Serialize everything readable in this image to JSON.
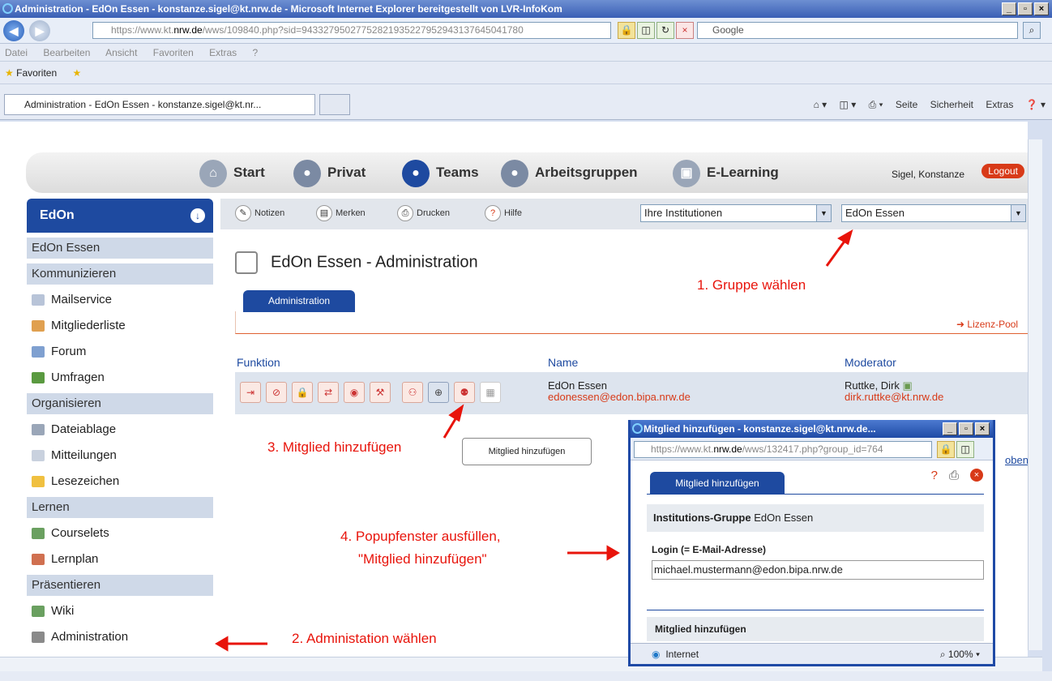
{
  "window": {
    "title": "Administration - EdOn Essen - konstanze.sigel@kt.nrw.de - Microsoft Internet Explorer bereitgestellt von LVR-InfoKom",
    "url_prefix": "https://www.kt.",
    "url_domain": "nrw.de",
    "url_rest": "/wws/109840.php?sid=94332795027752821935227952943137645041780",
    "search_placeholder": "Google",
    "menu": [
      "Datei",
      "Bearbeiten",
      "Ansicht",
      "Favoriten",
      "Extras",
      "?"
    ],
    "favorites": "Favoriten",
    "tab_title": "Administration - EdOn Essen - konstanze.sigel@kt.nr...",
    "cmd": [
      "Seite",
      "Sicherheit",
      "Extras"
    ]
  },
  "topnav": {
    "items": [
      "Start",
      "Privat",
      "Teams",
      "Arbeitsgruppen",
      "E-Learning"
    ],
    "user": "Sigel, Konstanze",
    "logout": "Logout"
  },
  "sidebar": {
    "header": "EdOn",
    "group": "EdOn Essen",
    "sections": [
      {
        "title": "Kommunizieren",
        "items": [
          "Mailservice",
          "Mitgliederliste",
          "Forum",
          "Umfragen"
        ]
      },
      {
        "title": "Organisieren",
        "items": [
          "Dateiablage",
          "Mitteilungen",
          "Lesezeichen"
        ]
      },
      {
        "title": "Lernen",
        "items": [
          "Courselets",
          "Lernplan"
        ]
      },
      {
        "title": "Präsentieren",
        "items": [
          "Wiki",
          "Administration"
        ]
      }
    ]
  },
  "toolbar": {
    "notizen": "Notizen",
    "merken": "Merken",
    "drucken": "Drucken",
    "hilfe": "Hilfe",
    "select1": "Ihre Institutionen",
    "select2": "EdOn Essen"
  },
  "main": {
    "title": "EdOn Essen - Administration",
    "tab": "Administration",
    "lizenz": "Lizenz-Pool",
    "col_funktion": "Funktion",
    "col_name": "Name",
    "col_moderator": "Moderator",
    "row_name": "EdOn Essen",
    "row_email": "edonessen@edon.bipa.nrw.de",
    "row_mod": "Ruttke, Dirk",
    "row_mod_email": "dirk.ruttke@kt.nrw.de",
    "tooltip": "Mitglied hinzufügen",
    "oben": "oben"
  },
  "annotations": {
    "a1": "1. Gruppe wählen",
    "a2": "2. Administation wählen",
    "a3": "3. Mitglied hinzufügen",
    "a4_line1": "4. Popupfenster ausfüllen,",
    "a4_line2": "\"Mitglied hinzufügen\""
  },
  "popup": {
    "title": "Mitglied hinzufügen - konstanze.sigel@kt.nrw.de...",
    "url_prefix": "https://www.kt.",
    "url_domain": "nrw.de",
    "url_rest": "/wws/132417.php?group_id=764",
    "tab": "Mitglied hinzufügen",
    "group_label": "Institutions-Gruppe",
    "group_value": "EdOn Essen",
    "login_label": "Login (= E-Mail-Adresse)",
    "login_value": "michael.mustermann@edon.bipa.nrw.de",
    "submit": "Mitglied hinzufügen",
    "status": "Internet",
    "zoom": "100%"
  }
}
